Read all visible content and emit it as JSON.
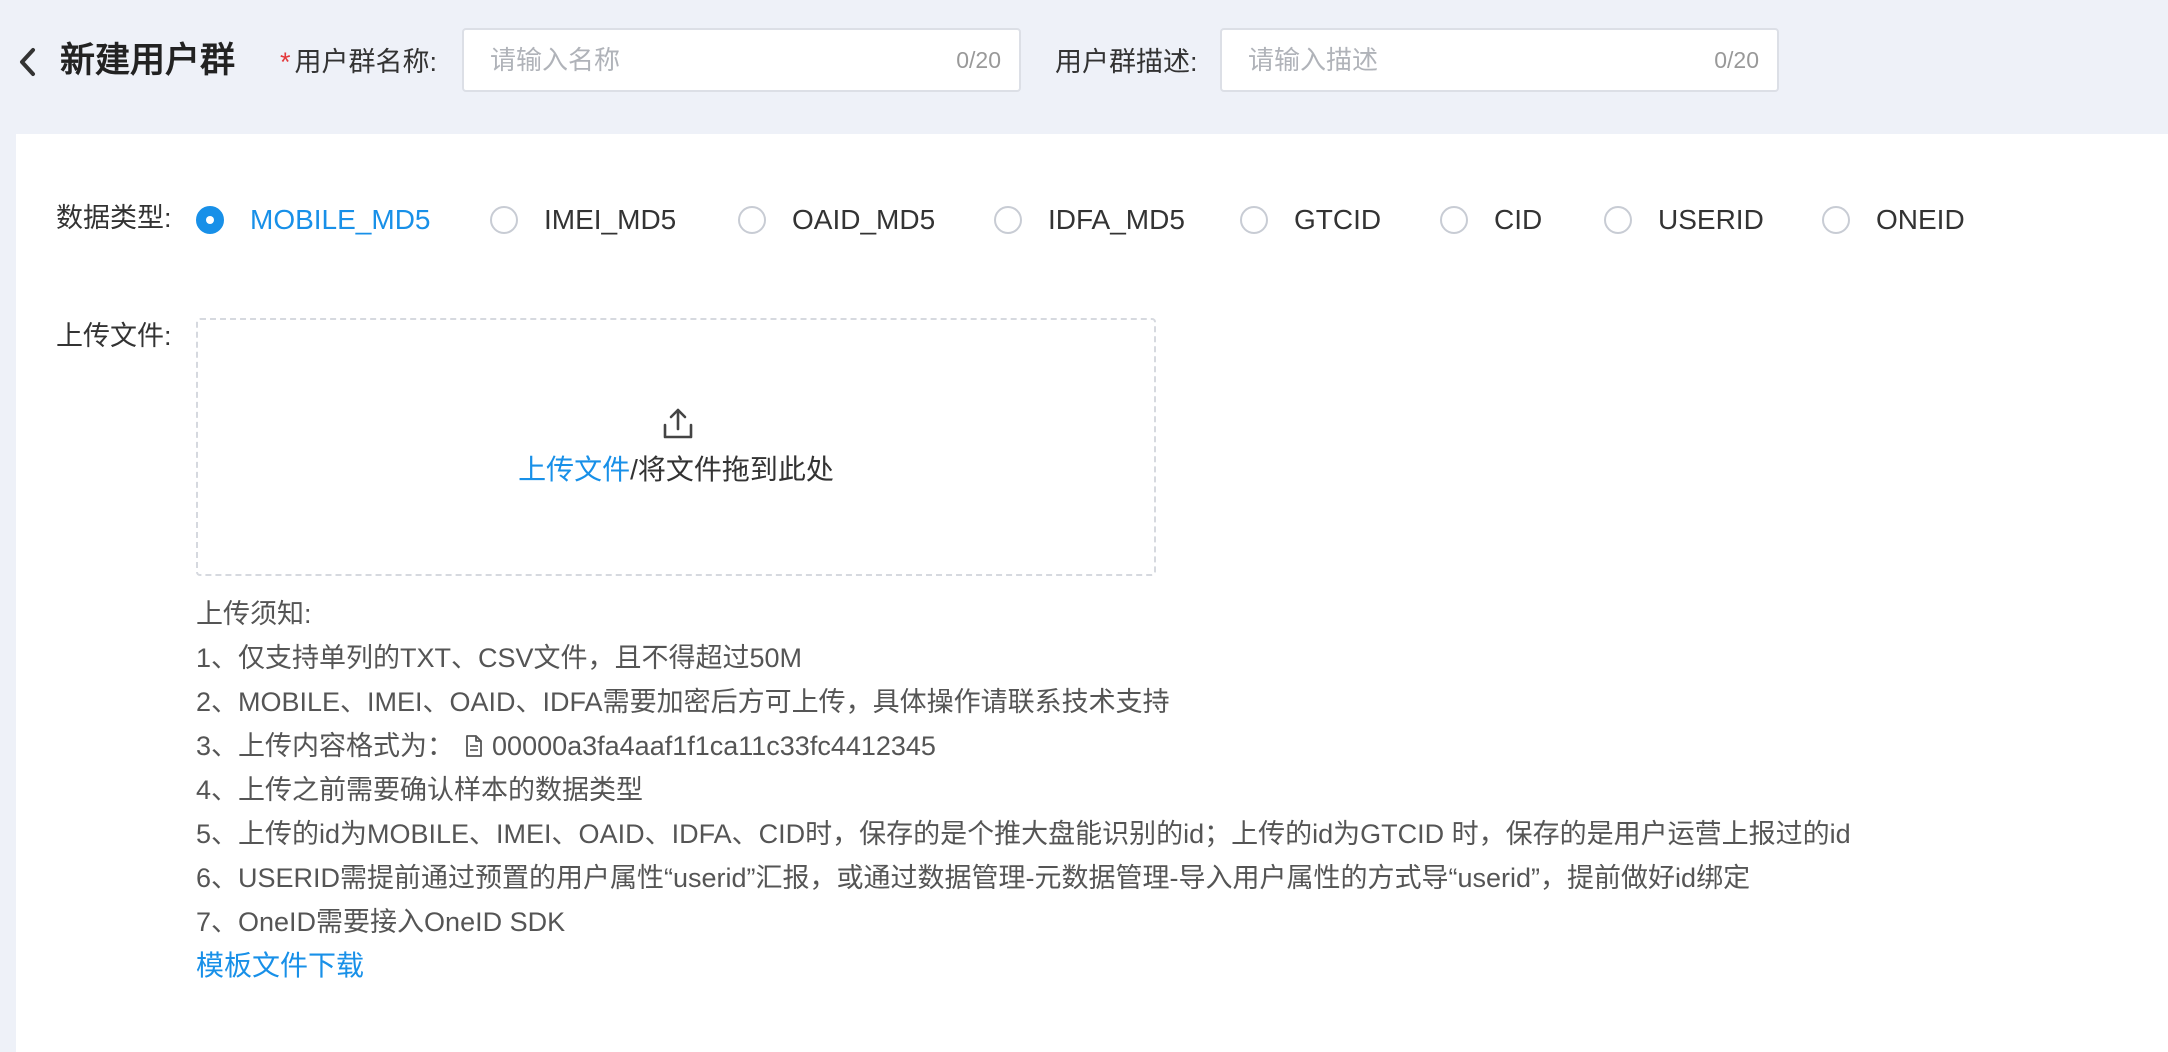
{
  "header": {
    "title": "新建用户群",
    "name_field": {
      "label": "用户群名称:",
      "required_mark": "*",
      "placeholder": "请输入名称",
      "value": "",
      "counter": "0/20"
    },
    "desc_field": {
      "label": "用户群描述:",
      "placeholder": "请输入描述",
      "value": "",
      "counter": "0/20"
    }
  },
  "data_type": {
    "label": "数据类型:",
    "selected": "MOBILE_MD5",
    "options": [
      "MOBILE_MD5",
      "IMEI_MD5",
      "OAID_MD5",
      "IDFA_MD5",
      "GTCID",
      "CID",
      "USERID",
      "ONEID"
    ]
  },
  "upload": {
    "label": "上传文件:",
    "link_text": "上传文件",
    "drag_text": "/将文件拖到此处",
    "notes_title": "上传须知:",
    "notes": [
      "1、仅支持单列的TXT、CSV文件，且不得超过50M",
      "2、MOBILE、IMEI、OAID、IDFA需要加密后方可上传，具体操作请联系技术支持",
      "3、上传内容格式为：",
      "4、上传之前需要确认样本的数据类型",
      "5、上传的id为MOBILE、IMEI、OAID、IDFA、CID时，保存的是个推大盘能识别的id；上传的id为GTCID 时，保存的是用户运营上报过的id",
      "6、USERID需提前通过预置的用户属性“userid”汇报，或通过数据管理-元数据管理-导入用户属性的方式导“userid”，提前做好id绑定",
      "7、OneID需要接入OneID SDK"
    ],
    "format_example": "00000a3fa4aaf1f1ca11c33fc4412345",
    "template_link": "模板文件下载"
  },
  "colors": {
    "accent": "#1890e8",
    "required": "#e4393c",
    "page_bg": "#eef1f8"
  },
  "icons": {
    "back": "chevron-left-icon",
    "upload": "upload-icon",
    "file": "file-icon"
  }
}
